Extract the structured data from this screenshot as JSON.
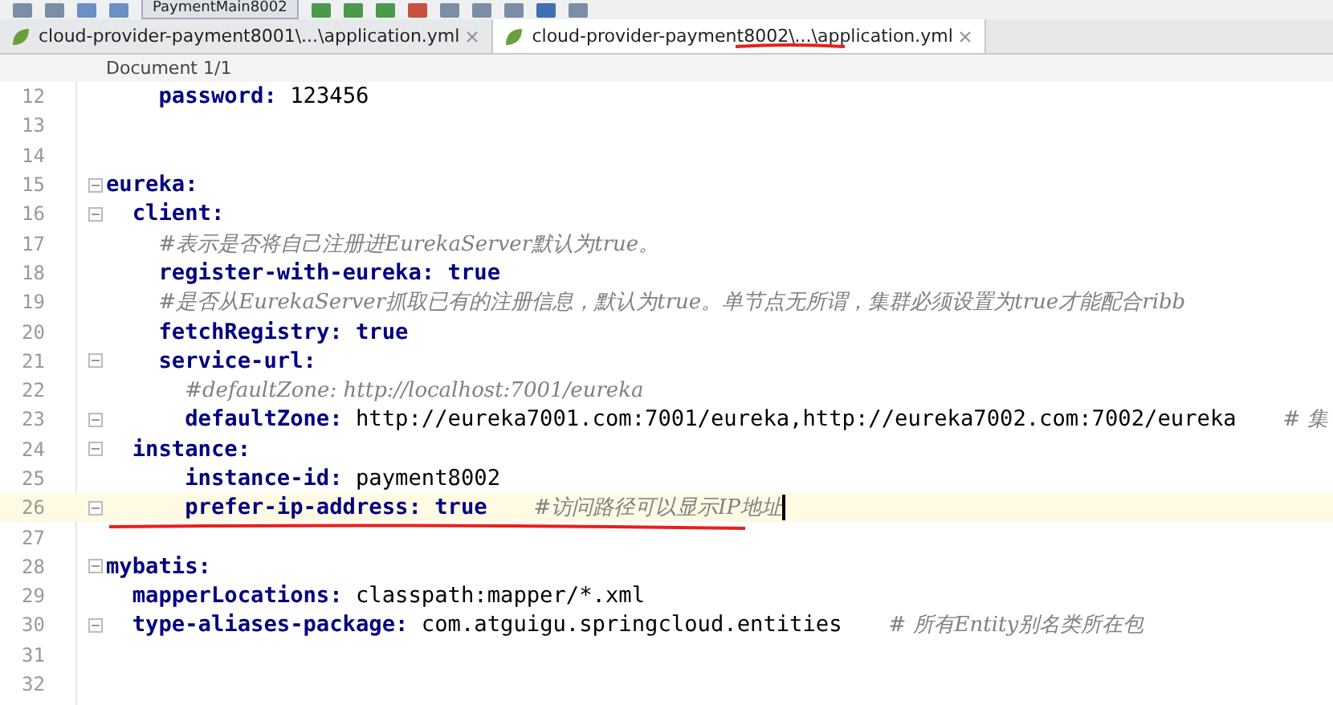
{
  "toolbar": {
    "run_config": "PaymentMain8002"
  },
  "tabs": [
    {
      "label": "cloud-provider-payment8001\\...\\application.yml",
      "selected": false
    },
    {
      "label": "cloud-provider-payment8002\\...\\application.yml",
      "selected": true
    }
  ],
  "breadcrumb": "Document 1/1",
  "lines": [
    {
      "kind": "offscreen",
      "children": [
        {
          "kind": "offscreen",
          "children": [
            {
              "kind": "pair",
              "number": "12",
              "key": "password:",
              "value": {
                "text": "123456",
                "kind": "text"
              },
              "fold": false,
              "current": false
            }
          ]
        }
      ]
    },
    {
      "kind": "blank",
      "number": "13",
      "fold": false,
      "current": false
    },
    {
      "kind": "blank",
      "number": "14",
      "fold": false,
      "current": false
    },
    {
      "kind": "pair",
      "number": "15",
      "key": "eureka:",
      "fold": true,
      "current": false,
      "children": [
        {
          "kind": "pair",
          "number": "16",
          "key": "client:",
          "fold": true,
          "current": false,
          "children": [
            {
              "kind": "comment",
              "number": "17",
              "comment": "#表示是否将自己注册进EurekaServer默认为true。",
              "fold": false,
              "current": false
            },
            {
              "kind": "pair",
              "number": "18",
              "key": "register-with-eureka:",
              "value": {
                "text": "true",
                "kind": "boolean"
              },
              "fold": false,
              "current": false
            },
            {
              "kind": "comment",
              "number": "19",
              "comment": "#是否从EurekaServer抓取已有的注册信息，默认为true。单节点无所谓，集群必须设置为true才能配合ribb",
              "fold": false,
              "current": false
            },
            {
              "kind": "pair",
              "number": "20",
              "key": "fetchRegistry:",
              "value": {
                "text": "true",
                "kind": "boolean"
              },
              "fold": false,
              "current": false
            },
            {
              "kind": "pair",
              "number": "21",
              "key": "service-url:",
              "fold": true,
              "current": false,
              "children": [
                {
                  "kind": "comment",
                  "number": "22",
                  "comment": "#defaultZone: http://localhost:7001/eureka",
                  "fold": false,
                  "current": false
                },
                {
                  "kind": "pair",
                  "number": "23",
                  "key": "defaultZone:",
                  "value": {
                    "text": "http://eureka7001.com:7001/eureka,http://eureka7002.com:7002/eureka",
                    "kind": "text"
                  },
                  "comment": "# 集",
                  "fold": true,
                  "current": false
                }
              ]
            }
          ]
        },
        {
          "kind": "pair",
          "number": "24",
          "key": "instance:",
          "fold": true,
          "current": false,
          "children": [
            {
              "kind": "offscreen",
              "children": [
                {
                  "kind": "pair",
                  "number": "25",
                  "key": "instance-id:",
                  "value": {
                    "text": "payment8002",
                    "kind": "text"
                  },
                  "fold": false,
                  "current": false
                },
                {
                  "kind": "pair",
                  "number": "26",
                  "key": "prefer-ip-address:",
                  "value": {
                    "text": "true",
                    "kind": "boolean"
                  },
                  "comment": "#访问路径可以显示IP地址",
                  "fold": true,
                  "current": true
                }
              ]
            }
          ]
        }
      ]
    },
    {
      "kind": "blank",
      "number": "27",
      "fold": false,
      "current": false
    },
    {
      "kind": "pair",
      "number": "28",
      "key": "mybatis:",
      "fold": true,
      "current": false,
      "children": [
        {
          "kind": "pair",
          "number": "29",
          "key": "mapperLocations:",
          "value": {
            "text": "classpath:mapper/*.xml",
            "kind": "text"
          },
          "fold": false,
          "current": false
        },
        {
          "kind": "pair",
          "number": "30",
          "key": "type-aliases-package:",
          "value": {
            "text": "com.atguigu.springcloud.entities",
            "kind": "text"
          },
          "comment": "# 所有Entity别名类所在包",
          "fold": true,
          "current": false
        }
      ]
    },
    {
      "kind": "blank",
      "number": "31",
      "fold": false,
      "current": false
    },
    {
      "kind": "blank",
      "number": "32",
      "fold": false,
      "current": false
    }
  ]
}
